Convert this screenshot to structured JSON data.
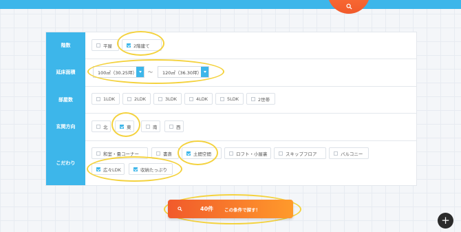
{
  "rows": {
    "floors": {
      "label": "階数",
      "options": [
        {
          "label": "平屋",
          "checked": false
        },
        {
          "label": "2階建て",
          "checked": true
        }
      ]
    },
    "area": {
      "label": "延床面積",
      "min": "100㎡（30.25坪）",
      "max": "120㎡（36.30坪）",
      "separator": "〜"
    },
    "rooms": {
      "label": "部屋数",
      "options": [
        {
          "label": "1LDK",
          "checked": false
        },
        {
          "label": "2LDK",
          "checked": false
        },
        {
          "label": "3LDK",
          "checked": false
        },
        {
          "label": "4LDK",
          "checked": false
        },
        {
          "label": "5LDK",
          "checked": false
        },
        {
          "label": "2世帯",
          "checked": false
        }
      ]
    },
    "entrance": {
      "label": "玄関方向",
      "options": [
        {
          "label": "北",
          "checked": false
        },
        {
          "label": "東",
          "checked": true
        },
        {
          "label": "南",
          "checked": false
        },
        {
          "label": "西",
          "checked": false
        }
      ]
    },
    "features": {
      "label": "こだわり",
      "options": [
        {
          "label": "和室・畳コーナー",
          "checked": false
        },
        {
          "label": "書斎",
          "checked": false
        },
        {
          "label": "土間空間",
          "checked": true
        },
        {
          "label": "ロフト・小屋裏",
          "checked": false
        },
        {
          "label": "スキップフロア",
          "checked": false
        },
        {
          "label": "バルコニー",
          "checked": false
        },
        {
          "label": "広々LDK",
          "checked": true
        },
        {
          "label": "収納たっぷり",
          "checked": true
        }
      ]
    }
  },
  "search_button": {
    "count": "40件",
    "label": "この条件で探す！"
  },
  "icons": {
    "top_fab": "search-icon",
    "search": "search-icon",
    "fab": "plus-icon"
  },
  "colors": {
    "accent": "#3db6ea",
    "cta_start": "#f15a2b",
    "cta_end": "#ff9a2b",
    "highlight": "#f4d23d"
  }
}
